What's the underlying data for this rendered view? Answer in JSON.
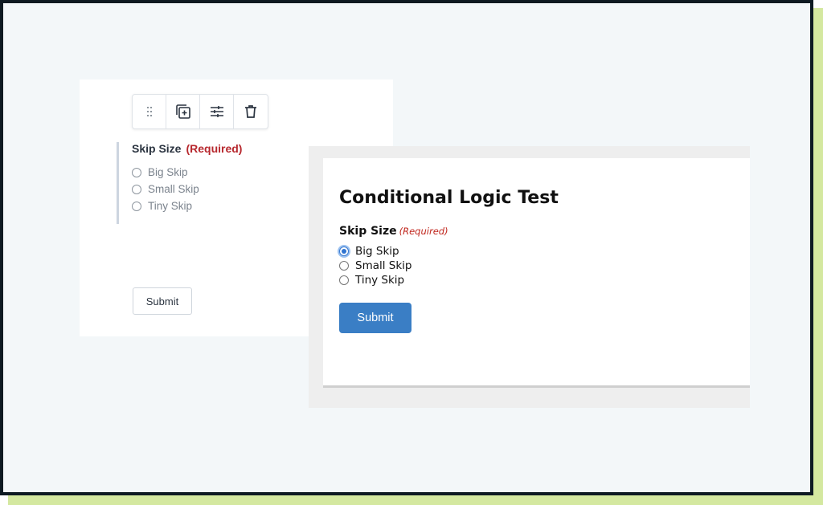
{
  "editor": {
    "toolbar": {
      "icons": [
        "drag-handle-icon",
        "duplicate-icon",
        "settings-sliders-icon",
        "trash-icon"
      ]
    },
    "field": {
      "label": "Skip Size",
      "required_text": "(Required)",
      "options": [
        "Big Skip",
        "Small Skip",
        "Tiny Skip"
      ]
    },
    "submit_label": "Submit"
  },
  "preview": {
    "title": "Conditional Logic Test",
    "field": {
      "label": "Skip Size",
      "required_text": "(Required)",
      "options": [
        "Big Skip",
        "Small Skip",
        "Tiny Skip"
      ],
      "selected": "Big Skip"
    },
    "submit_label": "Submit"
  },
  "colors": {
    "frame_border": "#0e1a22",
    "frame_background": "#f3f7f9",
    "accent_shadow": "#d4e8a0",
    "required_red": "#b7282e",
    "submit_blue": "#3a7ec5"
  }
}
